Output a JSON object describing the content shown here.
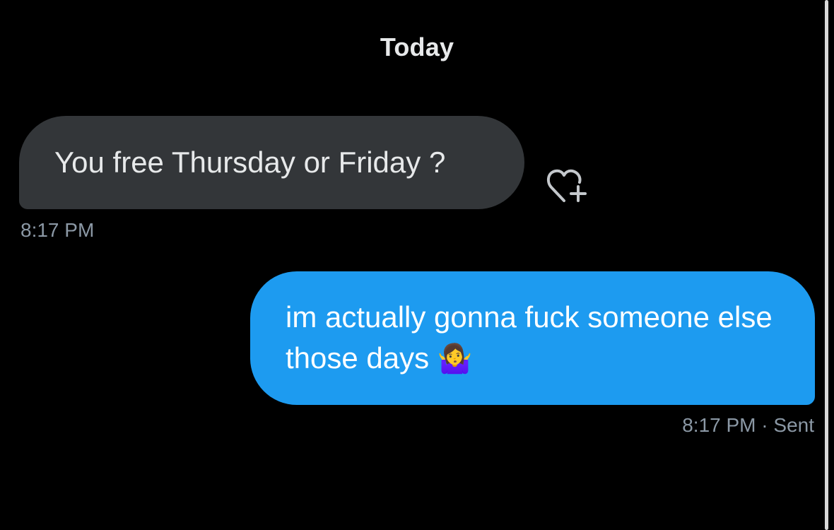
{
  "conversation": {
    "date_divider": "Today",
    "messages": [
      {
        "direction": "received",
        "text": "You free Thursday or Friday ?",
        "time": "8:17 PM"
      },
      {
        "direction": "sent",
        "text": "im actually gonna fuck someone else those days",
        "emoji": "🤷‍♀️",
        "time": "8:17 PM",
        "status": "· Sent"
      }
    ],
    "reaction_button_icon": "heart-plus-icon"
  },
  "colors": {
    "background": "#000000",
    "received_bubble": "#333639",
    "sent_bubble": "#1d9bf0",
    "timestamp": "#8b98a5",
    "text": "#e7e9ea"
  }
}
